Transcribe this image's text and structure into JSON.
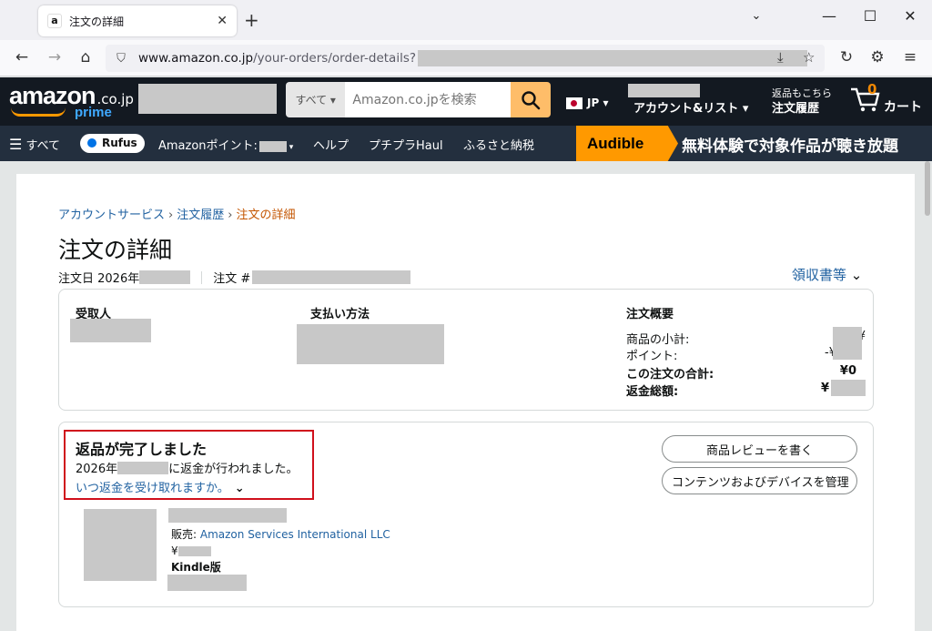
{
  "browser": {
    "tab_title": "注文の詳細",
    "tab_favicon": "a",
    "url_host": "www.amazon.co.jp",
    "url_path": "/your-orders/order-details?"
  },
  "header": {
    "logo_text": "amazon",
    "logo_suffix": ".co.jp",
    "logo_prime": "prime",
    "search_category": "すべて ▾",
    "search_placeholder": "Amazon.co.jpを検索",
    "lang": "JP ▾",
    "account_label": "アカウント&リスト ▾",
    "orders_small": "返品もこちら",
    "orders_label": "注文履歴",
    "cart_count": "0",
    "cart_label": "カート"
  },
  "subnav": {
    "all": "すべて",
    "rufus": "Rufus",
    "points": "Amazonポイント:",
    "help": "ヘルプ",
    "haul": "プチプラHaul",
    "furusato": "ふるさと納税",
    "audible_logo": "Audible",
    "audible_text": "無料体験で対象作品が聴き放題"
  },
  "breadcrumb": {
    "account": "アカウントサービス",
    "history": "注文履歴",
    "current": "注文の詳細"
  },
  "page": {
    "title": "注文の詳細",
    "order_date_label": "注文日 2026年",
    "order_number_label": "注文 #",
    "receipt": "領収書等"
  },
  "summary": {
    "recipient": "受取人",
    "payment": "支払い方法",
    "overview": "注文概要",
    "rows": [
      {
        "k": "商品の小計:",
        "v": "¥"
      },
      {
        "k": "ポイント:",
        "v": "-¥"
      },
      {
        "k": "この注文の合計:",
        "v": "¥0"
      },
      {
        "k": "返金総額:",
        "v": "¥"
      }
    ]
  },
  "shipment": {
    "status_title": "返品が完了しました",
    "refund_prefix": "2026年",
    "refund_suffix": "に返金が行われました。",
    "refund_link": "いつ返金を受け取れますか。",
    "btn_review": "商品レビューを書く",
    "btn_manage": "コンテンツおよびデバイスを管理",
    "seller_label": "販売:",
    "seller": "Amazon Services International LLC",
    "price_prefix": "¥",
    "format": "Kindle版"
  },
  "colors": {
    "header_bg": "#131921",
    "subnav_bg": "#232f3e",
    "search_button": "#febd69",
    "link": "#2162a1",
    "breadcrumb_current": "#c45500",
    "highlight_border": "#d0101c",
    "audible": "#ff9900"
  }
}
